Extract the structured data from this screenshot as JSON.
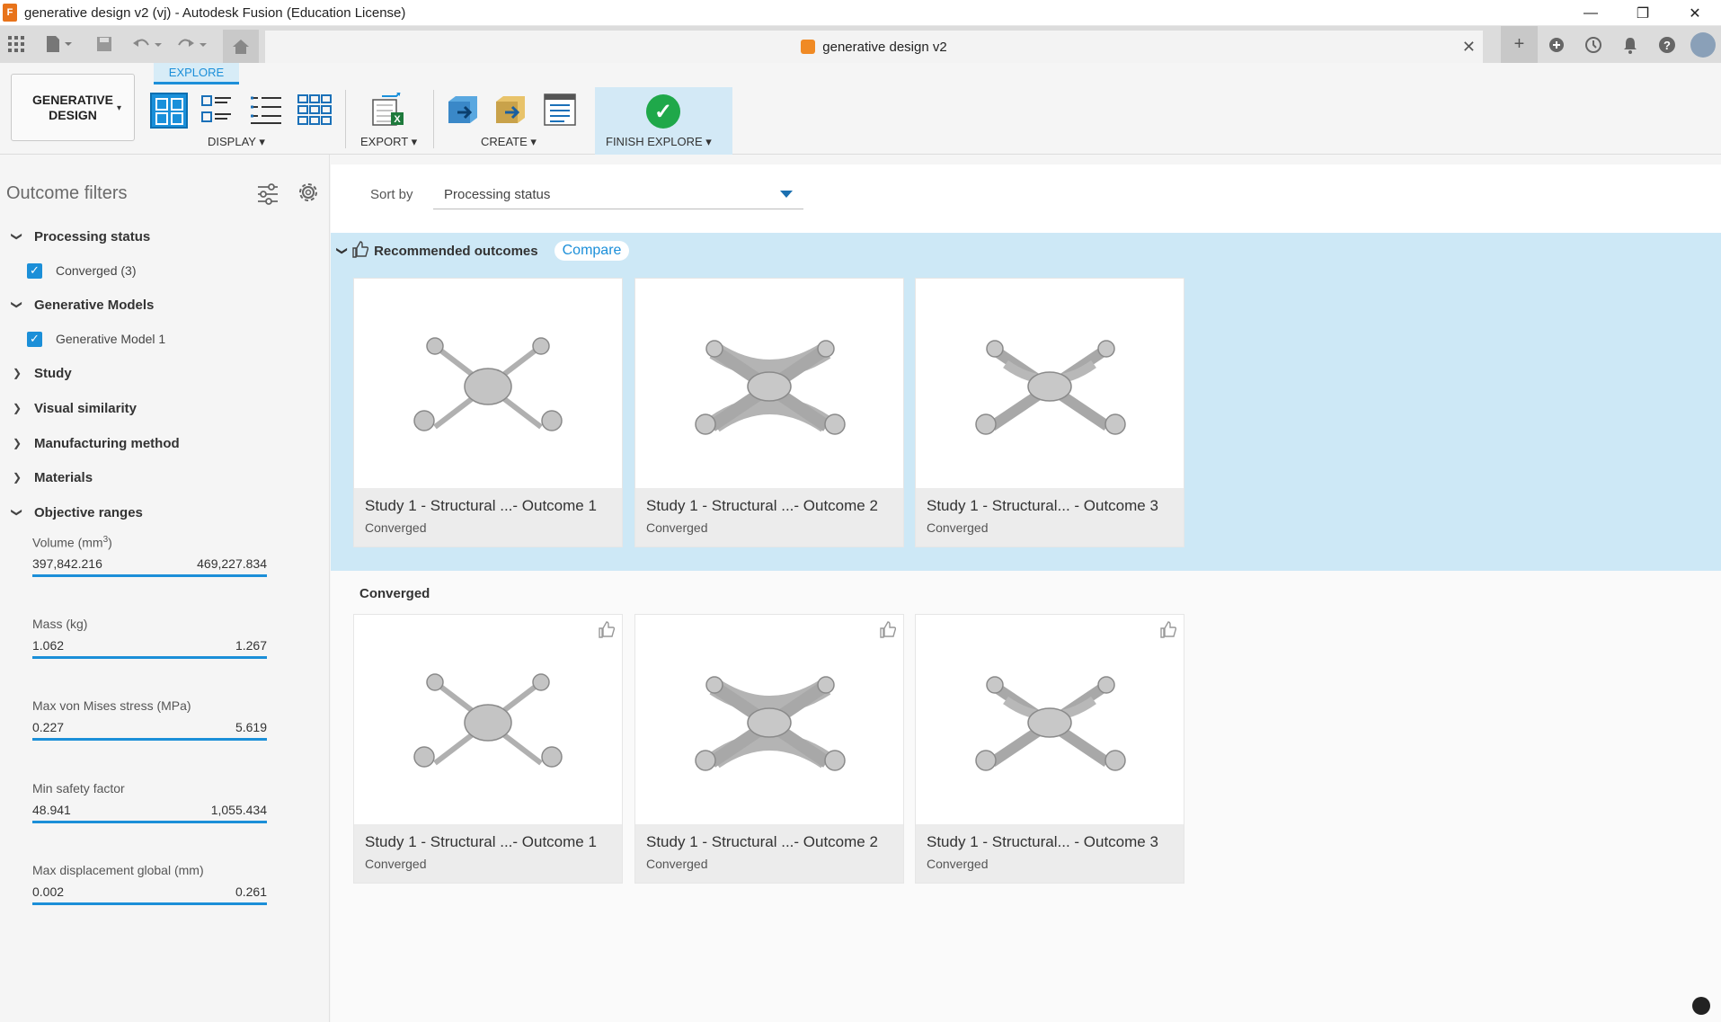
{
  "window": {
    "title": "generative design v2 (vj) - Autodesk Fusion (Education License)",
    "logo_letter": "F",
    "minimize": "—",
    "restore": "❐",
    "close": "✕"
  },
  "tabbar": {
    "doc_title": "generative design v2",
    "close": "✕"
  },
  "ribbon": {
    "workspace": "GENERATIVE DESIGN",
    "workspace_caret": "▾",
    "active_tab": "EXPLORE",
    "display_label": "DISPLAY ▾",
    "export_label": "EXPORT ▾",
    "create_label": "CREATE ▾",
    "finish_label": "FINISH EXPLORE ▾",
    "finish_check": "✓"
  },
  "sidebar": {
    "title": "Outcome filters",
    "sections": [
      {
        "label": "Processing status",
        "caret": "❯"
      },
      {
        "label": "Generative Models",
        "caret": "❯"
      },
      {
        "label": "Study",
        "caret": "❯"
      },
      {
        "label": "Visual similarity",
        "caret": "❯"
      },
      {
        "label": "Manufacturing method",
        "caret": "❯"
      },
      {
        "label": "Materials",
        "caret": "❯"
      },
      {
        "label": "Objective ranges",
        "caret": "❯"
      }
    ],
    "checks": [
      {
        "label": "Converged (3)",
        "mark": "✓"
      },
      {
        "label": "Generative Model 1",
        "mark": "✓"
      }
    ],
    "ranges": [
      {
        "label": "Volume (mm",
        "unit_sup": "3",
        "label_end": ")",
        "min": "397,842.216",
        "max": "469,227.834"
      },
      {
        "label": "Mass (kg)",
        "min": "1.062",
        "max": "1.267"
      },
      {
        "label": "Max von Mises stress (MPa)",
        "min": "0.227",
        "max": "5.619"
      },
      {
        "label": "Min safety factor",
        "min": "48.941",
        "max": "1,055.434"
      },
      {
        "label": "Max displacement global (mm)",
        "min": "0.002",
        "max": "0.261"
      }
    ]
  },
  "main": {
    "sort_label": "Sort by",
    "sort_value": "Processing status",
    "recommended_title": "Recommended outcomes",
    "compare_label": "Compare",
    "converged_title": "Converged",
    "recommended_cards": [
      {
        "title": "Study 1 - Structural ...- Outcome 1",
        "status": "Converged"
      },
      {
        "title": "Study 1 - Structural ...- Outcome 2",
        "status": "Converged"
      },
      {
        "title": "Study 1 - Structural... - Outcome 3",
        "status": "Converged"
      }
    ],
    "converged_cards": [
      {
        "title": "Study 1 - Structural ...- Outcome 1",
        "status": "Converged"
      },
      {
        "title": "Study 1 - Structural ...- Outcome 2",
        "status": "Converged"
      },
      {
        "title": "Study 1 - Structural... - Outcome 3",
        "status": "Converged"
      }
    ]
  },
  "colors": {
    "accent": "#1b8fd8",
    "recommended_band": "#cde8f6",
    "finish_check": "#1fa84a"
  }
}
